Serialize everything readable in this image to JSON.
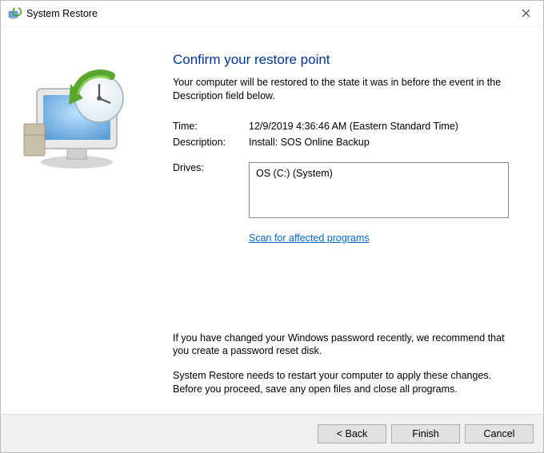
{
  "window": {
    "title": "System Restore"
  },
  "main": {
    "heading": "Confirm your restore point",
    "subtext": "Your computer will be restored to the state it was in before the event in the Description field below.",
    "fields": {
      "time_label": "Time:",
      "time_value": "12/9/2019 4:36:46 AM (Eastern Standard Time)",
      "description_label": "Description:",
      "description_value": "Install: SOS Online Backup",
      "drives_label": "Drives:",
      "drives_value": "OS (C:) (System)"
    },
    "scan_link": "Scan for affected programs",
    "note1": "If you have changed your Windows password recently, we recommend that you create a password reset disk.",
    "note2": "System Restore needs to restart your computer to apply these changes. Before you proceed, save any open files and close all programs."
  },
  "footer": {
    "back": "< Back",
    "finish": "Finish",
    "cancel": "Cancel"
  }
}
